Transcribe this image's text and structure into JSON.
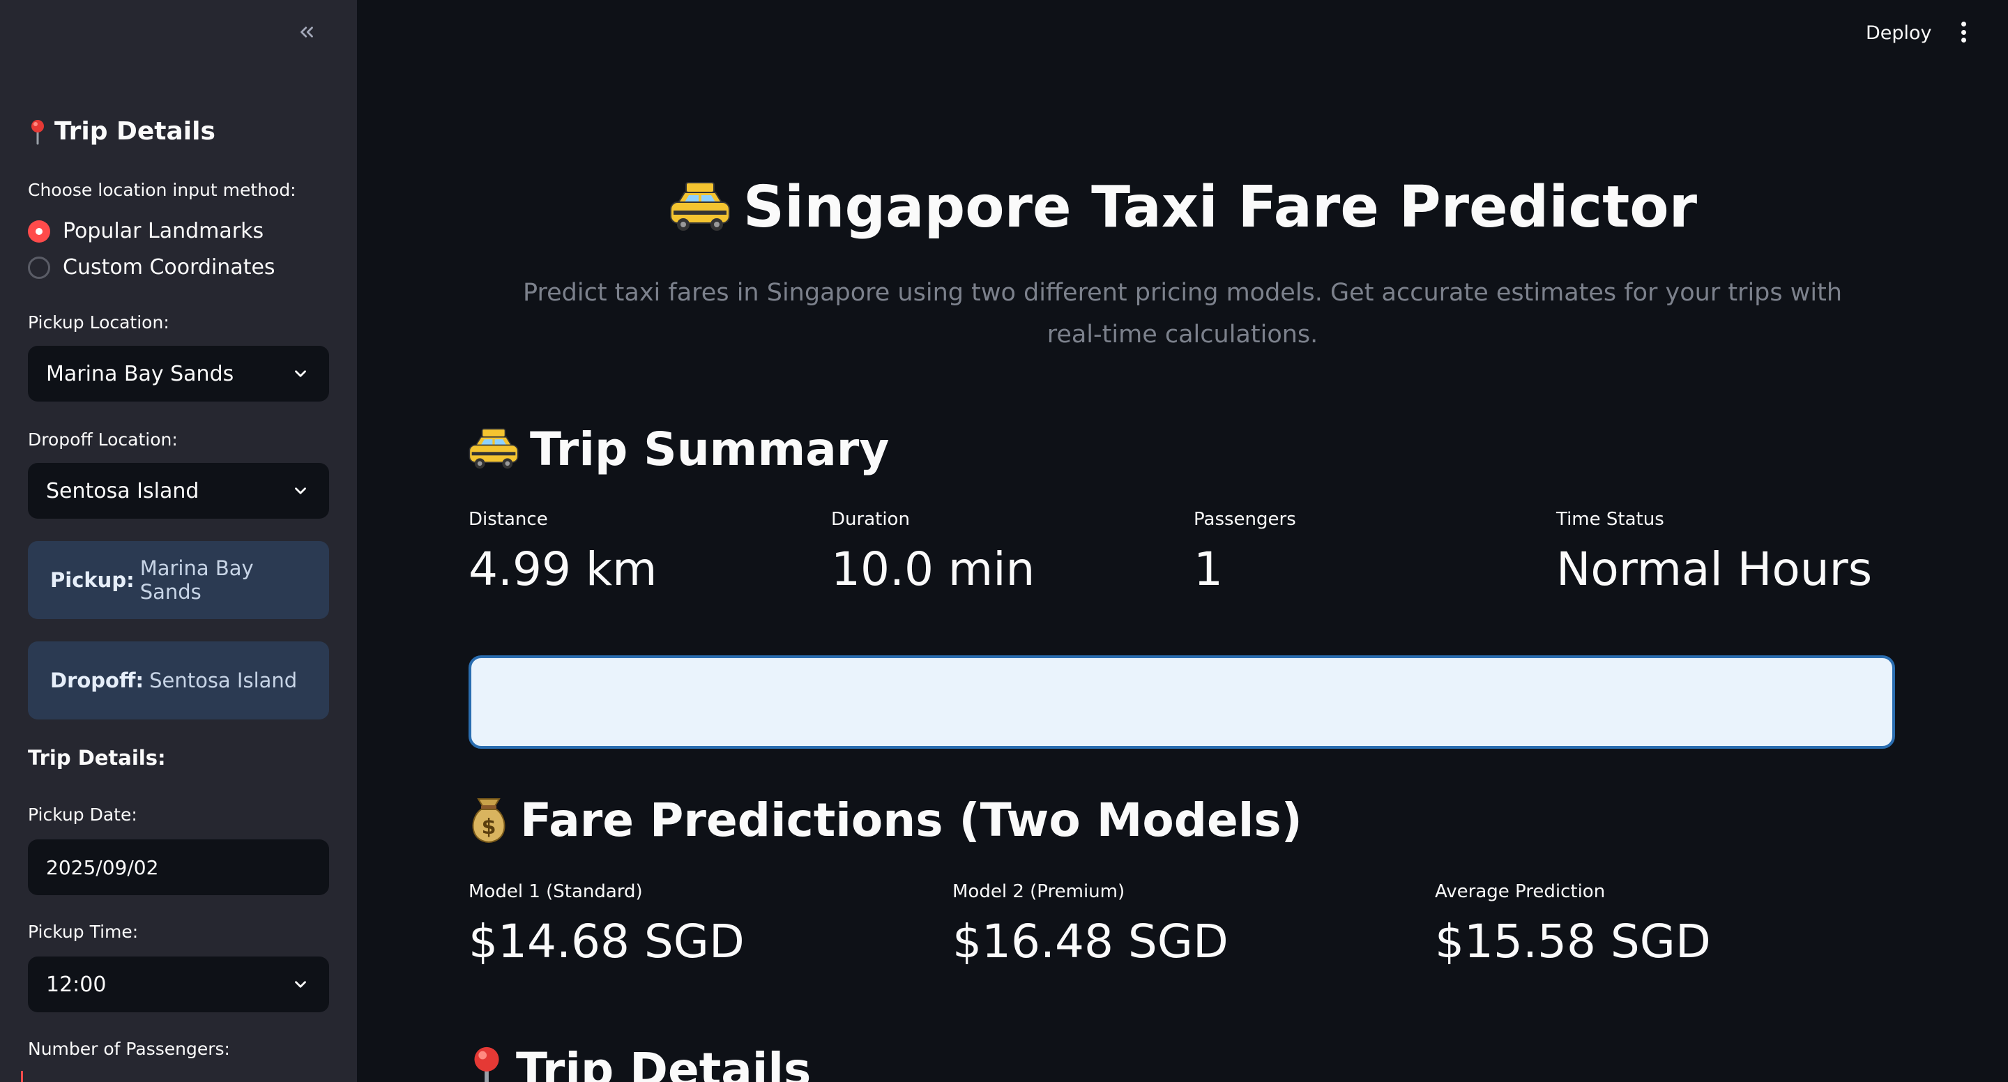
{
  "sidebar": {
    "heading": "Trip Details",
    "location_method_label": "Choose location input method:",
    "location_methods": [
      {
        "label": "Popular Landmarks",
        "selected": true
      },
      {
        "label": "Custom Coordinates",
        "selected": false
      }
    ],
    "pickup_label": "Pickup Location:",
    "pickup_value": "Marina Bay Sands",
    "dropoff_label": "Dropoff Location:",
    "dropoff_value": "Sentosa Island",
    "pickup_info": {
      "key": "Pickup:",
      "value": "Marina Bay Sands"
    },
    "dropoff_info": {
      "key": "Dropoff:",
      "value": "Sentosa Island"
    },
    "trip_details_label": "Trip Details:",
    "pickup_date_label": "Pickup Date:",
    "pickup_date_value": "2025/09/02",
    "pickup_time_label": "Pickup Time:",
    "pickup_time_value": "12:00",
    "passengers_label": "Number of Passengers:"
  },
  "header": {
    "deploy_label": "Deploy"
  },
  "main": {
    "title": "Singapore Taxi Fare Predictor",
    "subtitle": "Predict taxi fares in Singapore using two different pricing models. Get accurate estimates for your trips with real-time calculations.",
    "trip_summary": {
      "heading": "Trip Summary",
      "metrics": [
        {
          "label": "Distance",
          "value": "4.99 km"
        },
        {
          "label": "Duration",
          "value": "10.0 min"
        },
        {
          "label": "Passengers",
          "value": "1"
        },
        {
          "label": "Time Status",
          "value": "Normal Hours"
        }
      ]
    },
    "fare_predictions": {
      "heading": "Fare Predictions (Two Models)",
      "metrics": [
        {
          "label": "Model 1 (Standard)",
          "value": "$14.68 SGD"
        },
        {
          "label": "Model 2 (Premium)",
          "value": "$16.48 SGD"
        },
        {
          "label": "Average Prediction",
          "value": "$15.58 SGD"
        }
      ]
    },
    "trip_details_heading": "Trip Details"
  },
  "colors": {
    "background": "#0e1117",
    "sidebar": "#262730",
    "accent": "#ff4b4b",
    "info_box": "#2b3a52",
    "card_border": "#2a6db0"
  }
}
